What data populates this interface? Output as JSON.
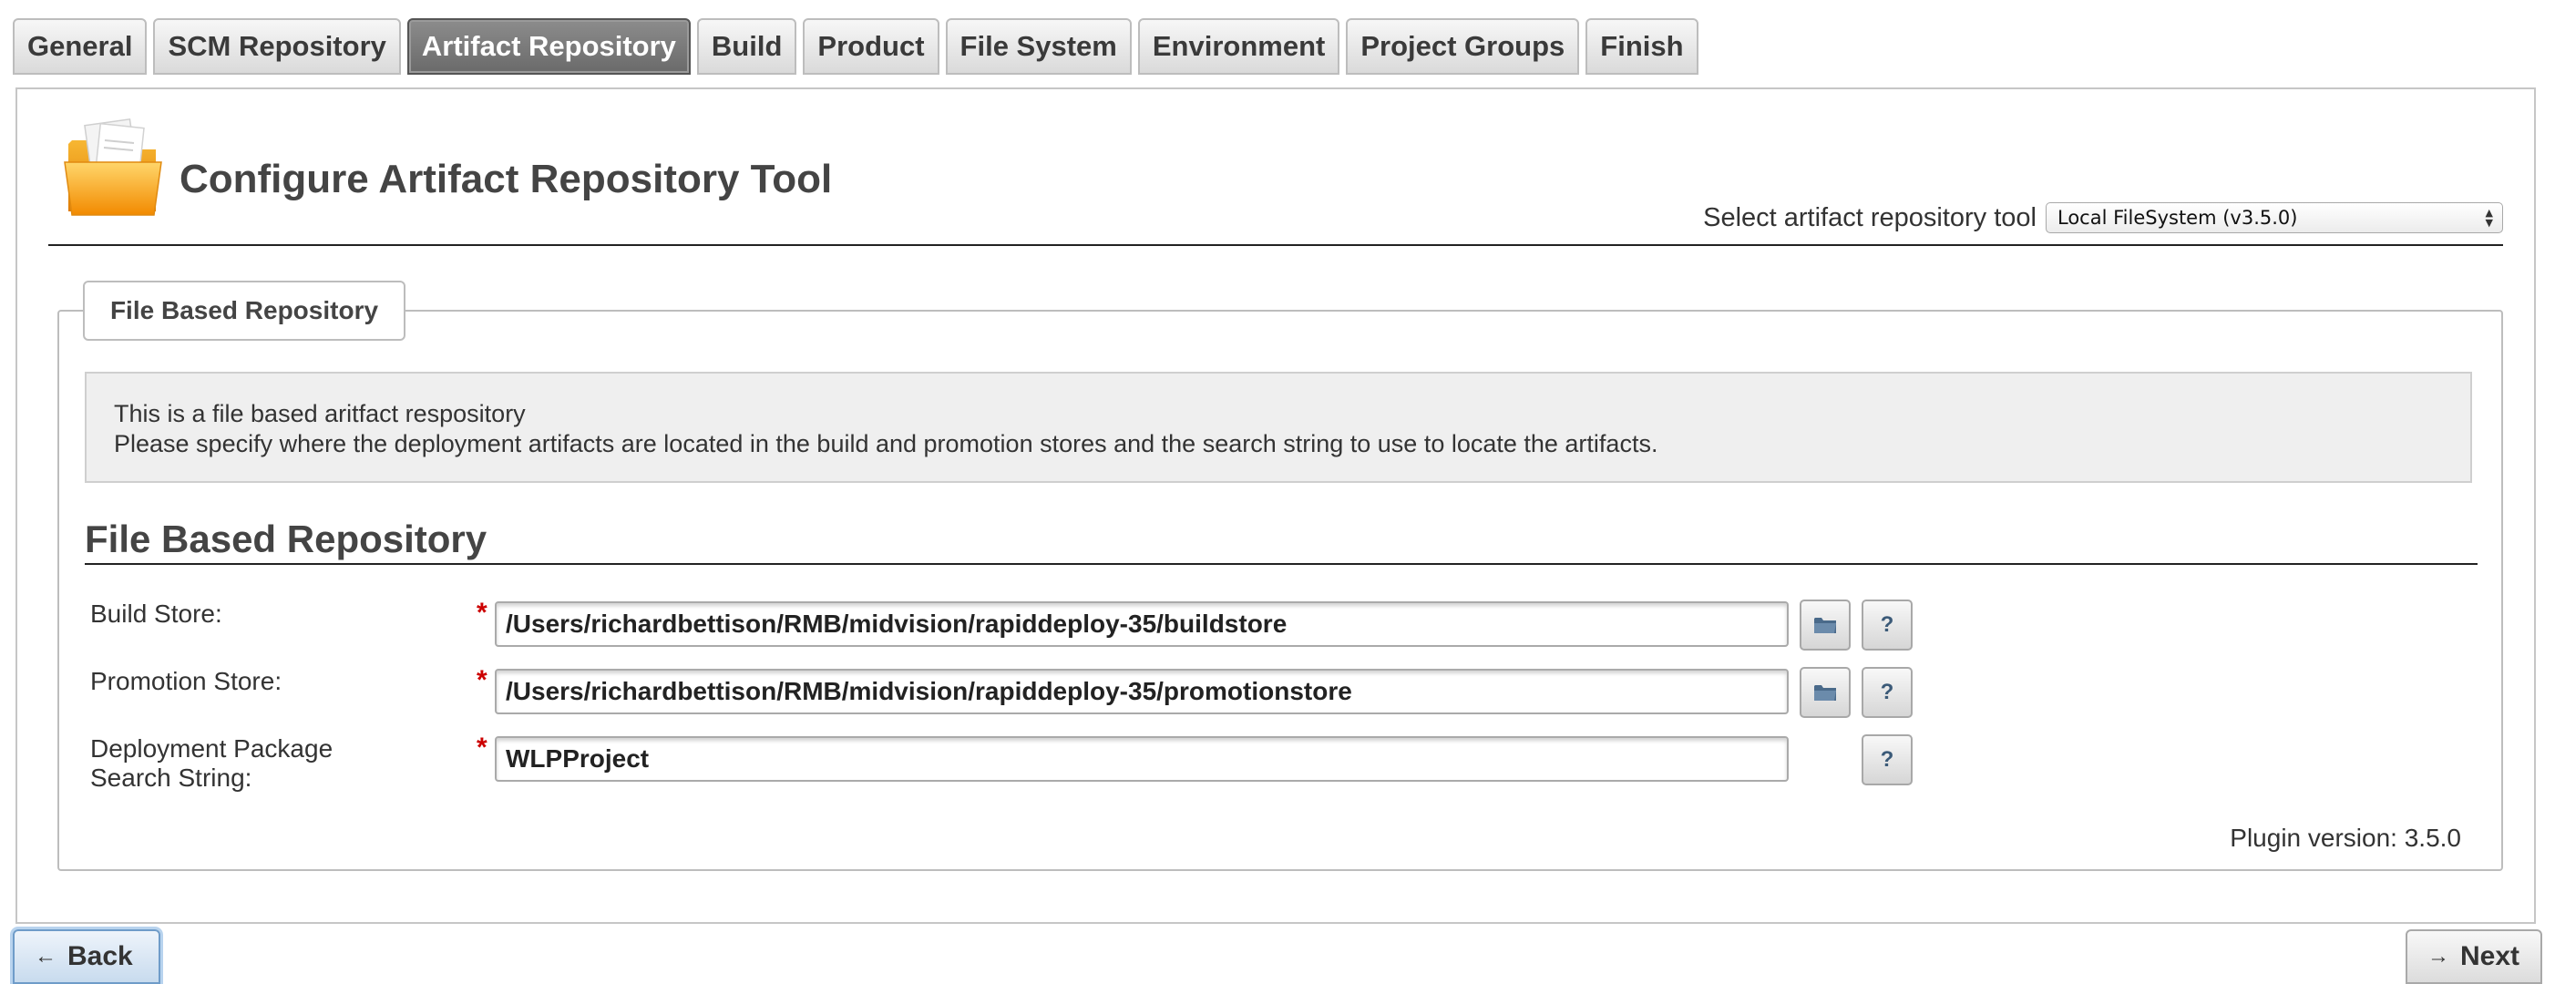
{
  "tabs": [
    {
      "label": "General"
    },
    {
      "label": "SCM Repository"
    },
    {
      "label": "Artifact Repository",
      "active": true
    },
    {
      "label": "Build"
    },
    {
      "label": "Product"
    },
    {
      "label": "File System"
    },
    {
      "label": "Environment"
    },
    {
      "label": "Project Groups"
    },
    {
      "label": "Finish"
    }
  ],
  "header": {
    "title": "Configure Artifact Repository Tool",
    "icon": "folder-documents-icon",
    "tool_select_label": "Select artifact repository tool",
    "tool_select_value": "Local FileSystem (v3.5.0)"
  },
  "fieldset": {
    "legend": "File Based Repository",
    "info_line_1": "This is a file based aritfact respository",
    "info_line_2": "Please specify where the deployment artifacts are located in the build and promotion stores and the search string to use to locate the artifacts.",
    "section_heading": "File Based Repository",
    "fields": {
      "build_store": {
        "label": "Build Store:",
        "value": "/Users/richardbettison/RMB/midvision/rapiddeploy-35/buildstore"
      },
      "promotion_store": {
        "label": "Promotion Store:",
        "value": "/Users/richardbettison/RMB/midvision/rapiddeploy-35/promotionstore"
      },
      "search_string": {
        "label_line_1": "Deployment Package",
        "label_line_2": "Search String:",
        "value": "WLPProject"
      }
    },
    "required_marker": "*",
    "help_label": "?",
    "plugin_version": "Plugin version: 3.5.0"
  },
  "nav": {
    "back_label": "Back",
    "next_label": "Next"
  },
  "colors": {
    "active_tab": "#7a7a7a",
    "required": "#cc0000",
    "folder_icon": "#f5a623"
  }
}
